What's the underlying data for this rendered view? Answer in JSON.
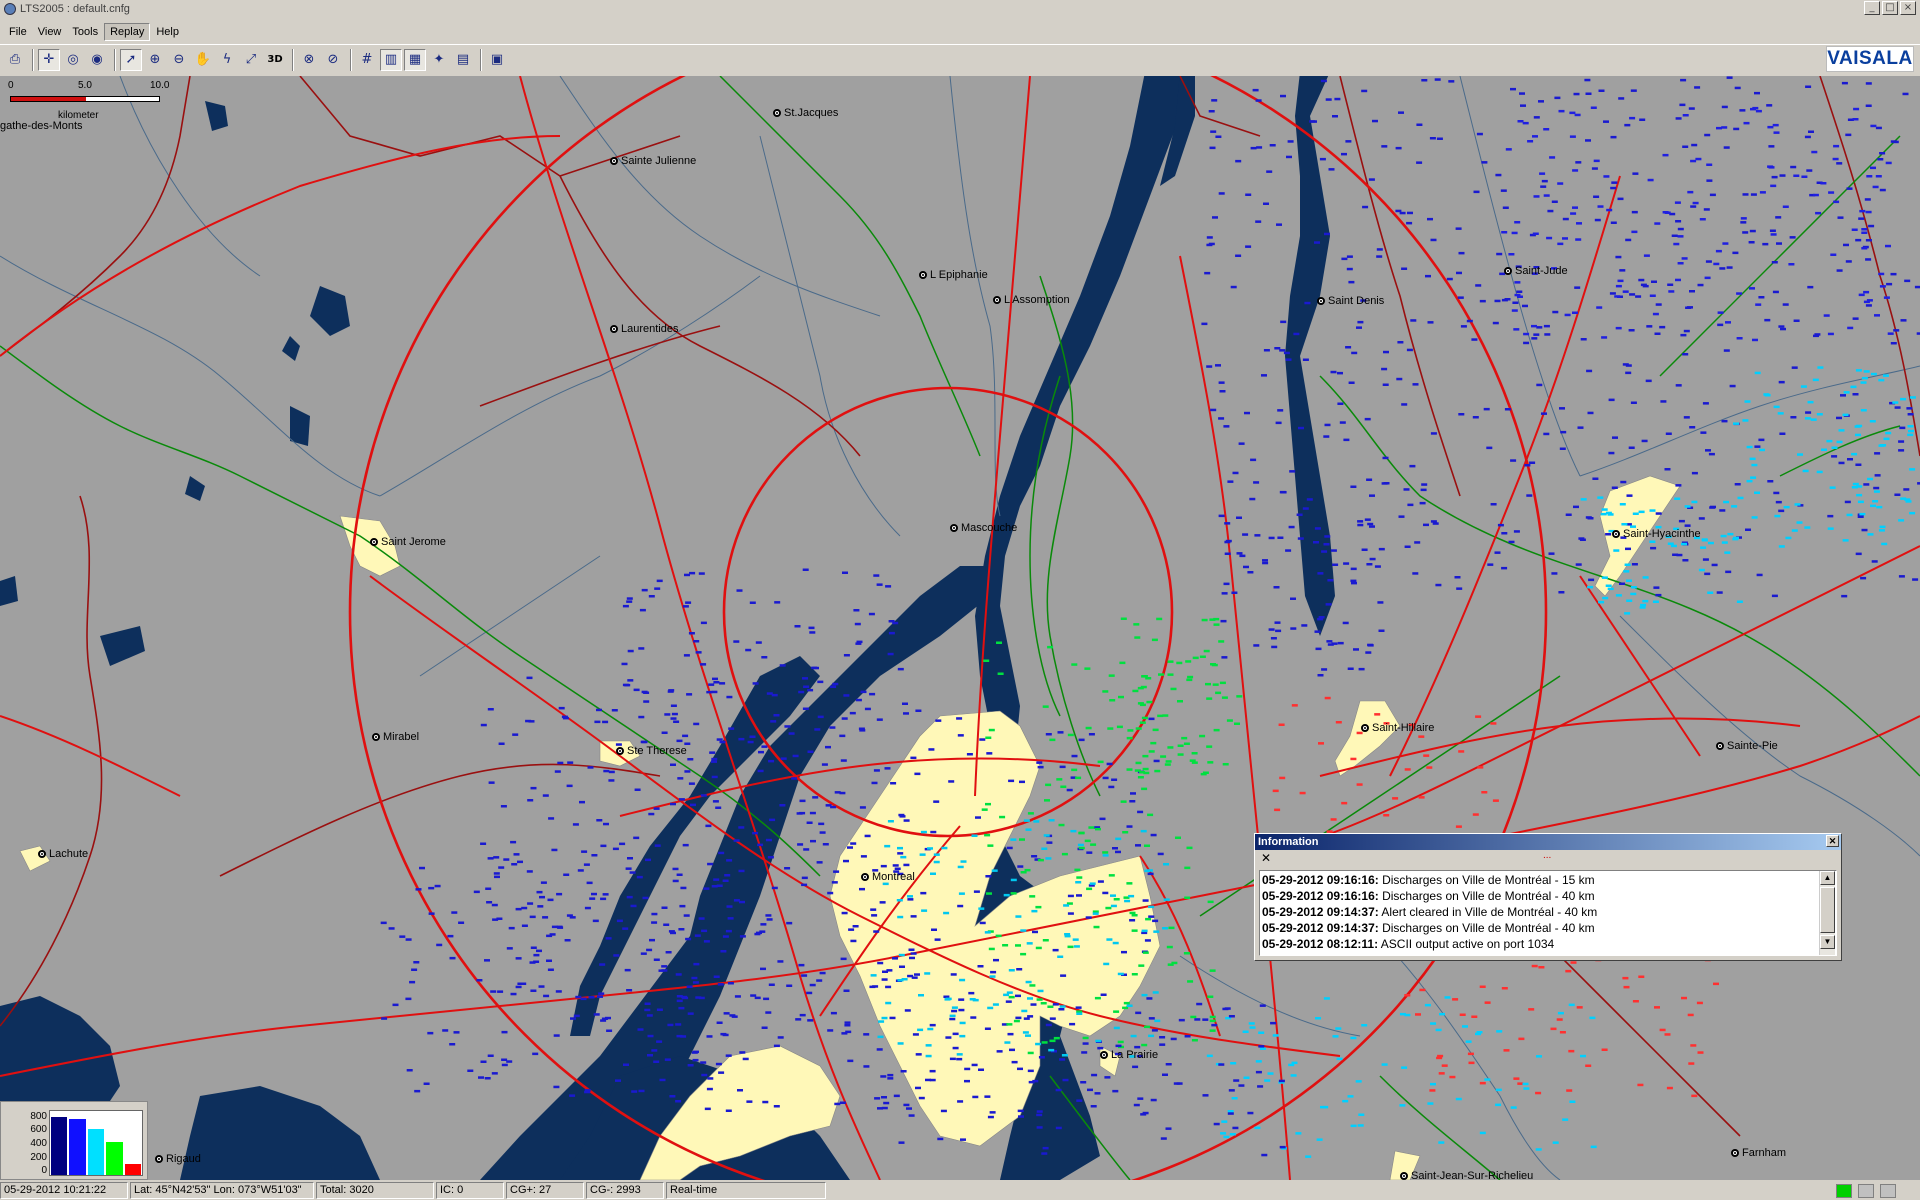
{
  "window": {
    "title": "LTS2005 : default.cnfg"
  },
  "menu": [
    "File",
    "View",
    "Tools",
    "Replay",
    "Help"
  ],
  "brand": {
    "logo": "VAISALA",
    "logo_color": "#0a3f9e"
  },
  "scale": {
    "t0": "0",
    "t1": "5.0",
    "t2": "10.0",
    "unit": "kilometer"
  },
  "map": {
    "corner_label": "gathe-des-Monts",
    "cities": [
      {
        "name": "St.Jacques"
      },
      {
        "name": "Sainte Julienne"
      },
      {
        "name": "L Epiphanie"
      },
      {
        "name": "L Assomption"
      },
      {
        "name": "Laurentides"
      },
      {
        "name": "Saint Denis"
      },
      {
        "name": "Saint-Jude"
      },
      {
        "name": "Saint Jerome"
      },
      {
        "name": "Mascouche"
      },
      {
        "name": "Saint-Hyacinthe"
      },
      {
        "name": "Mirabel"
      },
      {
        "name": "Ste Therese"
      },
      {
        "name": "Saint-Hillaire"
      },
      {
        "name": "Sainte-Pie"
      },
      {
        "name": "Lachute"
      },
      {
        "name": "Montreal"
      },
      {
        "name": "La Prairie"
      },
      {
        "name": "Rigaud"
      },
      {
        "name": "Farnham"
      },
      {
        "name": "Saint-Jean-Sur-Richelieu"
      }
    ],
    "colors": {
      "land": "#a0a0a0",
      "water": "#0d2f5c",
      "urban": "#fff8b8",
      "roads": "#e01010",
      "boundary_red": "#9a1010",
      "boundary_green": "#0a8a0a",
      "rivers": "#4a6a8a"
    }
  },
  "info": {
    "title": "Information",
    "rows": [
      {
        "ts": "05-29-2012 09:16:16:",
        "msg": " Discharges on Ville de Montréal - 15 km"
      },
      {
        "ts": "05-29-2012 09:16:16:",
        "msg": " Discharges on Ville de Montréal - 40 km"
      },
      {
        "ts": "05-29-2012 09:14:37:",
        "msg": " Alert cleared in Ville de Montréal - 40 km"
      },
      {
        "ts": "05-29-2012 09:14:37:",
        "msg": " Discharges on Ville de Montréal - 40 km"
      },
      {
        "ts": "05-29-2012 08:12:11:",
        "msg": " ASCII output active on port 1034"
      }
    ]
  },
  "histogram": {
    "ylabels": [
      "800",
      "600",
      "400",
      "200",
      "0"
    ],
    "bars": [
      {
        "value": 820,
        "color": "#000080"
      },
      {
        "value": 790,
        "color": "#1010ff"
      },
      {
        "value": 650,
        "color": "#00e0ff"
      },
      {
        "value": 460,
        "color": "#00ff00"
      },
      {
        "value": 150,
        "color": "#ff0000"
      }
    ],
    "ymax": 900
  },
  "status": {
    "datetime": "05-29-2012 10:21:22",
    "position": "Lat: 45°N42'53\"  Lon: 073°W51'03\"",
    "total": "Total: 3020",
    "ic": "IC: 0",
    "cgp": "CG+: 27",
    "cgn": "CG-: 2993",
    "mode": "Real-time",
    "indicator_colors": [
      "#00d000",
      "#c0c0c0",
      "#c0c0c0"
    ]
  }
}
